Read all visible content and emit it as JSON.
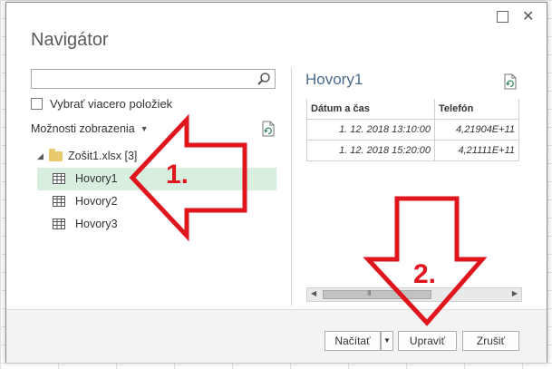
{
  "dialog": {
    "title": "Navigátor",
    "close_glyph": "✕"
  },
  "left": {
    "search_placeholder": "",
    "search_value": "",
    "select_multiple_label": "Vybrať viacero položiek",
    "display_options_label": "Možnosti zobrazenia",
    "tree": {
      "file": {
        "name": "Zošit1.xlsx [3]"
      },
      "items": [
        {
          "name": "Hovory1",
          "selected": true
        },
        {
          "name": "Hovory2",
          "selected": false
        },
        {
          "name": "Hovory3",
          "selected": false
        }
      ]
    }
  },
  "preview": {
    "title": "Hovory1",
    "columns": [
      "Dátum a čas",
      "Telefón"
    ],
    "rows": [
      [
        "1. 12. 2018 13:10:00",
        "4,21904E+11"
      ],
      [
        "1. 12. 2018 15:20:00",
        "4,21111E+11"
      ]
    ],
    "scroll_grip": "III"
  },
  "footer": {
    "load_label": "Načítať",
    "edit_label": "Upraviť",
    "cancel_label": "Zrušiť"
  },
  "annotations": {
    "step1": "1.",
    "step2": "2.",
    "color": "#e0161e"
  }
}
